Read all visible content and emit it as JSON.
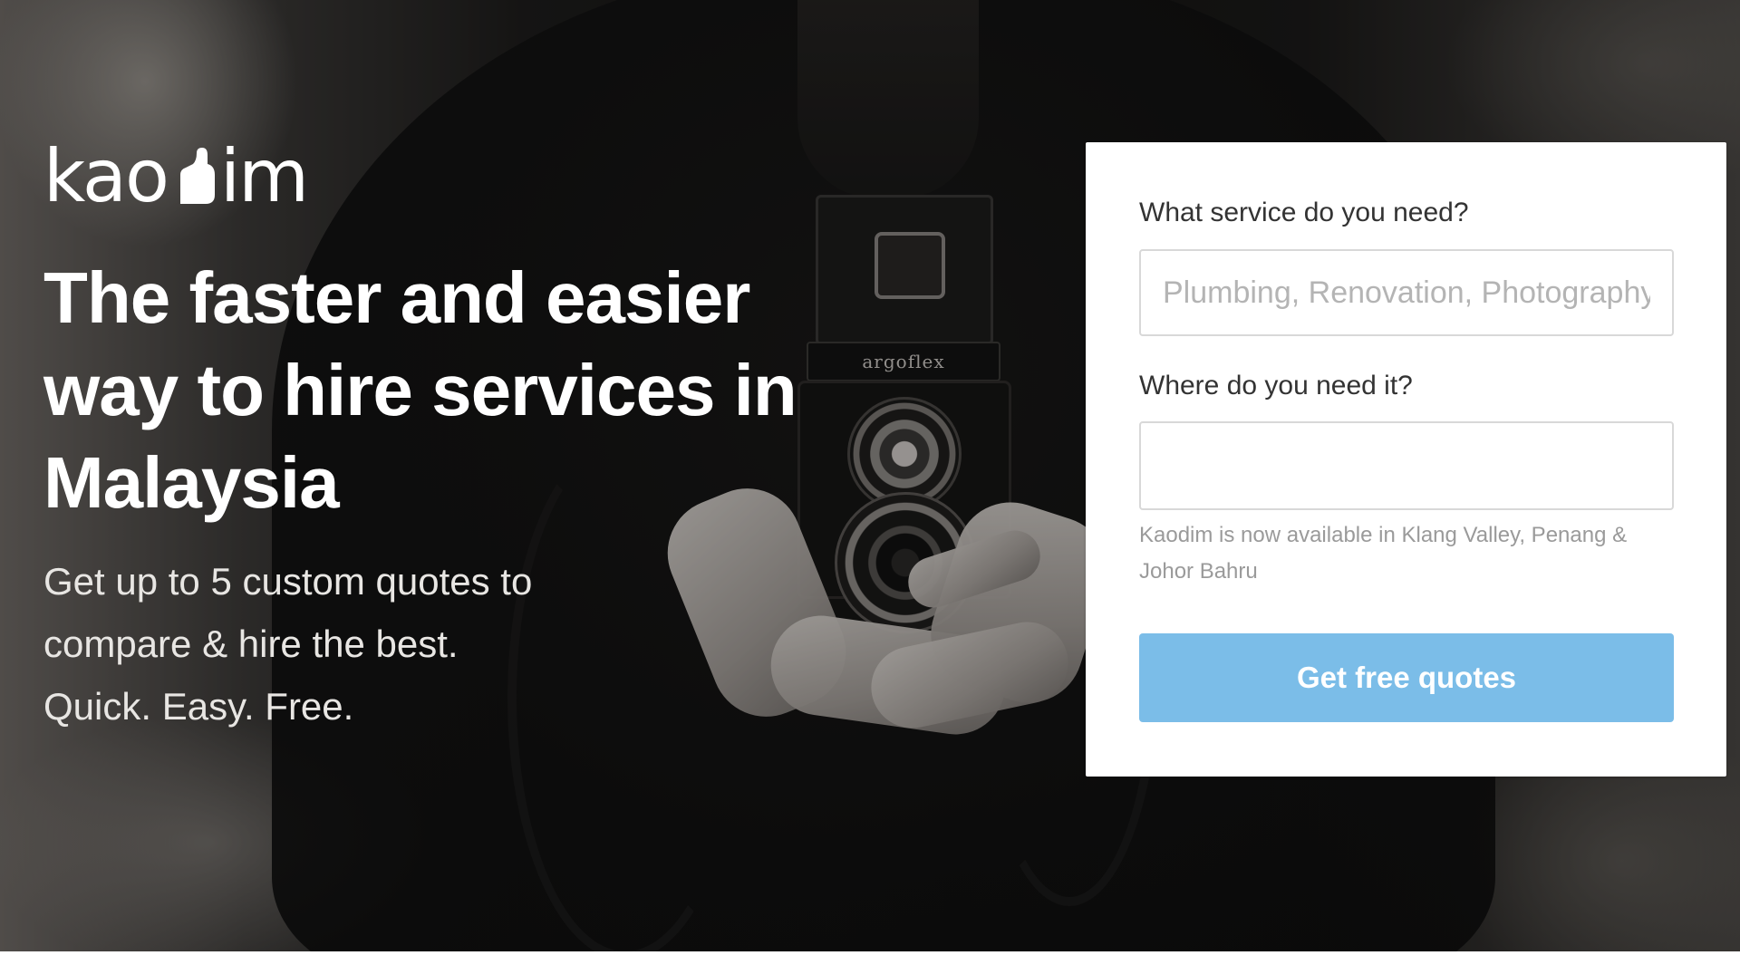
{
  "brand": {
    "logo_prefix": "kao",
    "logo_suffix": "im",
    "logo_icon": "thumbs-up-icon"
  },
  "hero": {
    "headline": "The faster and easier way to hire services in Malaysia",
    "subcopy_line1": "Get up to 5 custom quotes to",
    "subcopy_line2": "compare & hire the best.",
    "subcopy_line3": "Quick. Easy. Free.",
    "camera_brand": "argoflex"
  },
  "form": {
    "service_label": "What service do you need?",
    "service_placeholder": "Plumbing, Renovation, Photography",
    "service_value": "",
    "location_label": "Where do you need it?",
    "location_placeholder": "",
    "location_value": "",
    "availability_hint": "Kaodim is now available in Klang Valley, Penang & Johor Bahru",
    "submit_label": "Get free quotes"
  },
  "colors": {
    "cta_background": "#7bbde8",
    "cta_text": "#ffffff",
    "card_background": "#ffffff",
    "label_text": "#333333",
    "hint_text": "#9a9a9a"
  }
}
